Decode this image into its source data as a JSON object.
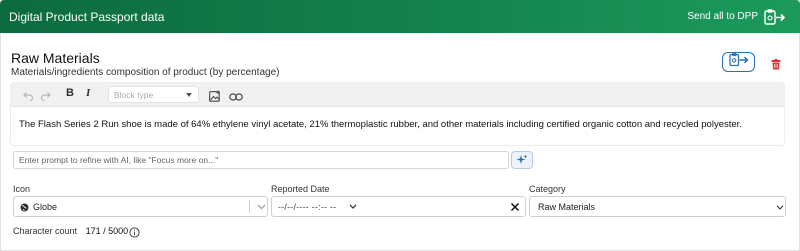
{
  "header": {
    "title": "Digital Product Passport data",
    "send_all_label": "Send all to DPP",
    "gradient_start": "#0c6b3f",
    "gradient_end": "#1c9a5c"
  },
  "section": {
    "title": "Raw Materials",
    "subtitle": "Materials/ingredients composition of product (by percentage)"
  },
  "toolbar": {
    "bold_label": "B",
    "italic_label": "I",
    "block_type_placeholder": "Block type"
  },
  "editor": {
    "content": "The Flash Series 2 Run shoe is made of 64% ethylene vinyl acetate, 21% thermoplastic rubber, and other materials including certified organic cotton and recycled polyester."
  },
  "ai_prompt": {
    "placeholder": "Enter prompt to refine with AI, like \"Focus more on...\""
  },
  "fields": {
    "icon": {
      "label": "Icon",
      "value": "Globe"
    },
    "reported_date": {
      "label": "Reported Date",
      "value": "--/--/---- --:-- --"
    },
    "category": {
      "label": "Category",
      "value": "Raw Materials"
    }
  },
  "footer": {
    "char_count_label": "Character count",
    "char_count_value": "171 / 5000"
  },
  "colors": {
    "accent_blue": "#2f6fb0",
    "delete_red": "#d9363e"
  }
}
